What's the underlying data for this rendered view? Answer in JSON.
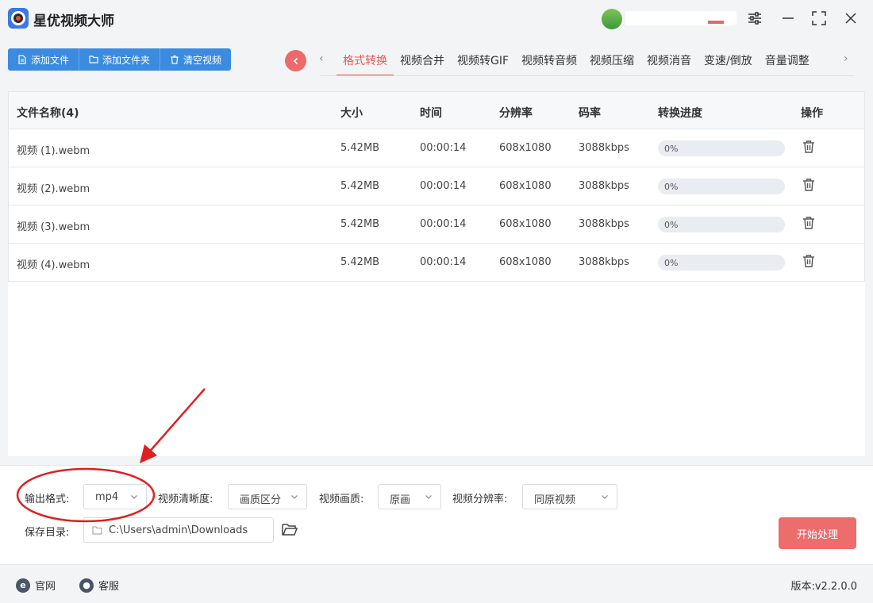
{
  "app": {
    "title": "星优视频大师"
  },
  "toolbar": {
    "add_file": "添加文件",
    "add_folder": "添加文件夹",
    "clear": "清空视频"
  },
  "tabs": [
    {
      "label": "格式转换",
      "active": true
    },
    {
      "label": "视频合并"
    },
    {
      "label": "视频转GIF"
    },
    {
      "label": "视频转音频"
    },
    {
      "label": "视频压缩"
    },
    {
      "label": "视频消音"
    },
    {
      "label": "变速/倒放"
    },
    {
      "label": "音量调整"
    }
  ],
  "table": {
    "headers": [
      "文件名称(4)",
      "大小",
      "时间",
      "分辨率",
      "码率",
      "转换进度",
      "操作"
    ],
    "rows": [
      {
        "name": "视频 (1).webm",
        "size": "5.42MB",
        "time": "00:00:14",
        "resolution": "608x1080",
        "bitrate": "3088kbps",
        "progress": "0%",
        "progress_value": 0
      },
      {
        "name": "视频 (2).webm",
        "size": "5.42MB",
        "time": "00:00:14",
        "resolution": "608x1080",
        "bitrate": "3088kbps",
        "progress": "0%",
        "progress_value": 0
      },
      {
        "name": "视频 (3).webm",
        "size": "5.42MB",
        "time": "00:00:14",
        "resolution": "608x1080",
        "bitrate": "3088kbps",
        "progress": "0%",
        "progress_value": 0
      },
      {
        "name": "视频 (4).webm",
        "size": "5.42MB",
        "time": "00:00:14",
        "resolution": "608x1080",
        "bitrate": "3088kbps",
        "progress": "0%",
        "progress_value": 0
      }
    ]
  },
  "settings": {
    "format_label": "输出格式:",
    "format_value": "mp4",
    "clarity_label": "视频清晰度:",
    "clarity_value": "画质区分",
    "quality_label": "视频画质:",
    "quality_value": "原画",
    "resolution_label": "视频分辨率:",
    "resolution_value": "同原视频",
    "save_label": "保存目录:",
    "save_path": "C:\\Users\\admin\\Downloads",
    "start_button": "开始处理"
  },
  "footer": {
    "website": "官网",
    "support": "客服",
    "version": "版本:v2.2.0.0"
  },
  "colors": {
    "accent_blue": "#3b8be0",
    "accent_red": "#e8594f",
    "annotation_red": "#e02020"
  },
  "icons": [
    "app-logo-icon",
    "settings-sliders-icon",
    "minimize-icon",
    "maximize-icon",
    "close-icon",
    "file-icon",
    "folder-icon",
    "trash-icon",
    "chevron-left-icon",
    "chevron-right-icon",
    "chevron-down-icon",
    "folder-open-icon",
    "globe-e-icon",
    "chat-icon"
  ]
}
